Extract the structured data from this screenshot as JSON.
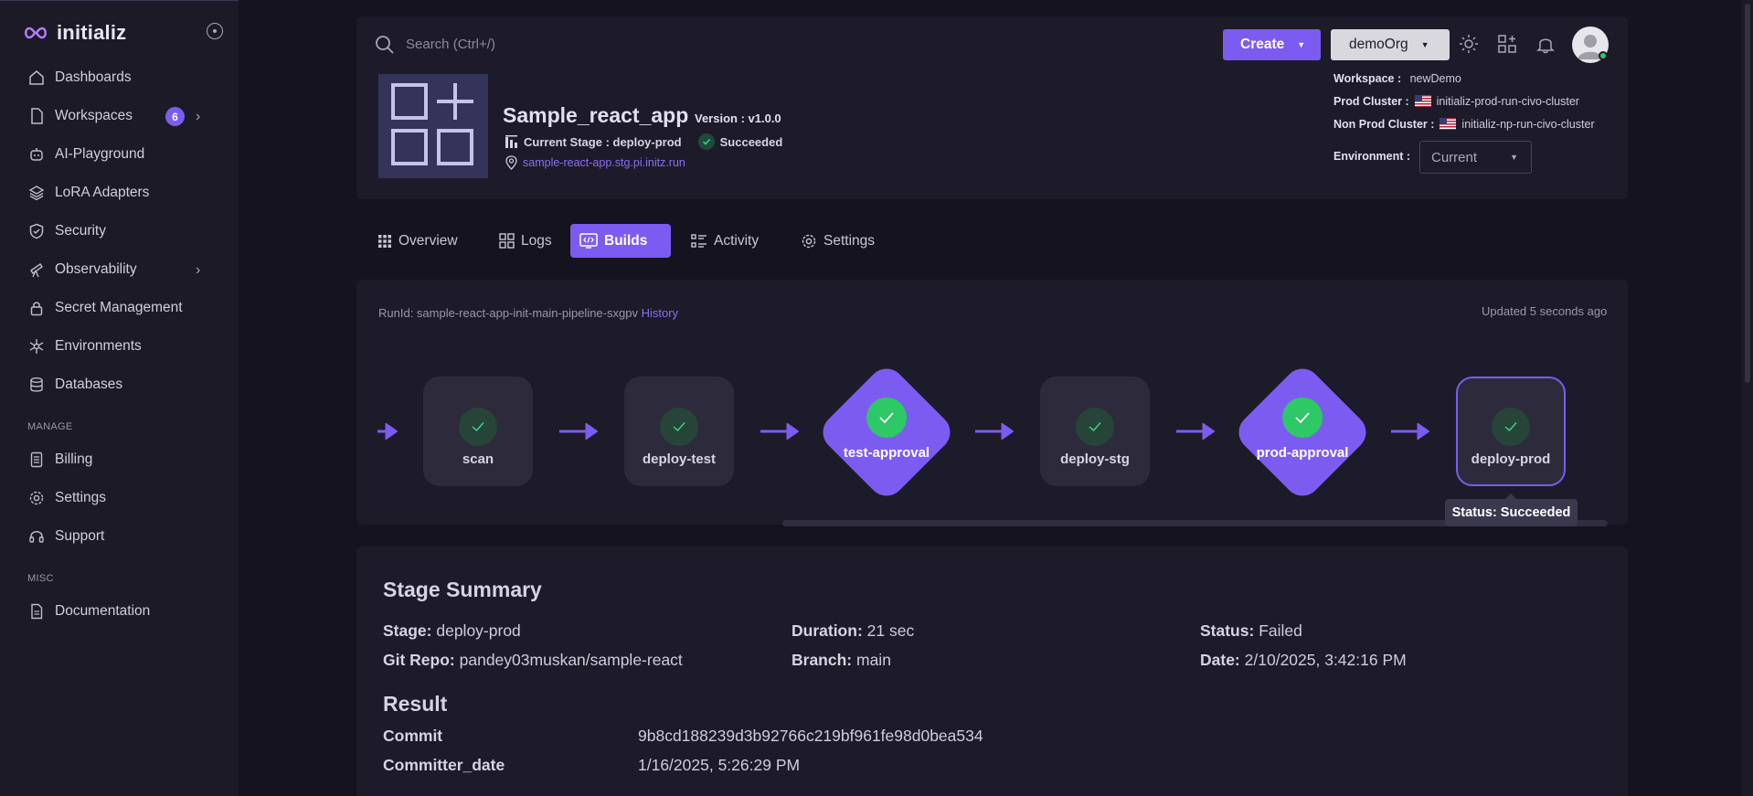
{
  "brand": {
    "name": "initializ"
  },
  "sidebar": {
    "items": [
      {
        "label": "Dashboards"
      },
      {
        "label": "Workspaces",
        "badge": "6"
      },
      {
        "label": "AI-Playground"
      },
      {
        "label": "LoRA Adapters"
      },
      {
        "label": "Security"
      },
      {
        "label": "Observability"
      },
      {
        "label": "Secret Management"
      },
      {
        "label": "Environments"
      },
      {
        "label": "Databases"
      }
    ],
    "manage_label": "MANAGE",
    "manage_items": [
      {
        "label": "Billing"
      },
      {
        "label": "Settings"
      },
      {
        "label": "Support"
      }
    ],
    "misc_label": "MISC",
    "misc_items": [
      {
        "label": "Documentation"
      }
    ]
  },
  "header": {
    "search_placeholder": "Search (Ctrl+/)",
    "create_label": "Create",
    "org_label": "demoOrg"
  },
  "app": {
    "name": "Sample_react_app",
    "version": "Version : v1.0.0",
    "current_stage": "Current Stage : deploy-prod",
    "stage_status": "Succeeded",
    "url": "sample-react-app.stg.pi.initz.run"
  },
  "meta": {
    "workspace_key": "Workspace :",
    "workspace_val": "newDemo",
    "prod_cluster_key": "Prod Cluster :",
    "prod_cluster_val": "initializ-prod-run-civo-cluster",
    "nonprod_cluster_key": "Non Prod Cluster :",
    "nonprod_cluster_val": "initializ-np-run-civo-cluster",
    "environment_key": "Environment :",
    "environment_val": "Current"
  },
  "tabs": [
    {
      "label": "Overview"
    },
    {
      "label": "Logs"
    },
    {
      "label": "Builds",
      "active": true
    },
    {
      "label": "Activity"
    },
    {
      "label": "Settings"
    }
  ],
  "pipeline": {
    "runid_label": "RunId: sample-react-app-init-main-pipeline-sxgpv",
    "history_label": "History",
    "updated": "Updated 5 seconds ago",
    "stages": [
      {
        "label": "scan",
        "kind": "task",
        "status": "succeeded"
      },
      {
        "label": "deploy-test",
        "kind": "task",
        "status": "succeeded"
      },
      {
        "label": "test-approval",
        "kind": "approval",
        "status": "succeeded"
      },
      {
        "label": "deploy-stg",
        "kind": "task",
        "status": "succeeded"
      },
      {
        "label": "prod-approval",
        "kind": "approval",
        "status": "succeeded"
      },
      {
        "label": "deploy-prod",
        "kind": "task",
        "status": "succeeded",
        "selected": true
      }
    ],
    "tooltip": "Status: Succeeded"
  },
  "summary": {
    "title": "Stage Summary",
    "stage_key": "Stage:",
    "stage_val": "deploy-prod",
    "duration_key": "Duration:",
    "duration_val": "21 sec",
    "status_key": "Status:",
    "status_val": "Failed",
    "repo_key": "Git Repo:",
    "repo_val": "pandey03muskan/sample-react",
    "branch_key": "Branch:",
    "branch_val": "main",
    "date_key": "Date:",
    "date_val": "2/10/2025, 3:42:16 PM"
  },
  "result": {
    "title": "Result",
    "commit_key": "Commit",
    "commit_val": "9b8cd188239d3b92766c219bf961fe98d0bea534",
    "committer_date_key": "Committer_date",
    "committer_date_val": "1/16/2025, 5:26:29 PM"
  },
  "colors": {
    "accent": "#7c5cf0",
    "success": "#2ec866",
    "background": "#15131f",
    "card": "#1d1b29"
  }
}
